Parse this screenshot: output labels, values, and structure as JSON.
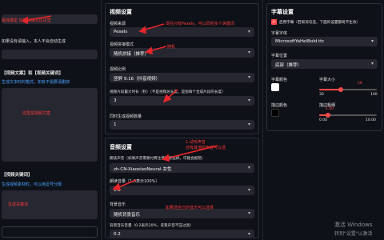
{
  "left": {
    "topInputValue": "",
    "topNote": "最强模型 内容请填写在这里",
    "hint1": "如果没有请输入，本人不会自动生成",
    "hint2": "【视频文案】和【视频关键词】",
    "blueHint1": "生成文本时的格式，如有不需要请删掉",
    "textareaNote": "这里是视频文案",
    "sectionTitle": "【视频关键词】",
    "blueHint2": "生成视频素材时，可以用逗号分隔",
    "keywordNote": "生成关键词"
  },
  "mid": {
    "sectionTitle": "视频设置",
    "sourceLabel": "视频来源",
    "sourceValue": "Pexels",
    "sourceNote": "现在只有Pexels，可以同时多个关键词",
    "concatLabel": "视频拼接模式",
    "concatValue": "随机拼接（推荐）",
    "concatNote": "随机",
    "ratioLabel": "视频比例",
    "ratioValue": "竖屏 9:16（抖音视频）",
    "clipLabel": "视频片段最大时长（秒）（不是视频总长度，是指每个合成片段的长度）",
    "clipValue": "3",
    "countLabel": "同时生成视频数量",
    "countValue": "1",
    "audioTitle": "音频设置",
    "voiceLabel": "朗读声音（如果声音需要付费注意不要选择，可能会报错）",
    "voiceValue": "zh-CN-XiaoxiaoNeural-女性",
    "voiceNote1": "1.试听声音",
    "voiceNote2": "还有其他的声音可以选",
    "volumeLabel": "朗读音量（1.0表示100%）",
    "volumeValue": "1.0",
    "bgmLabel": "背景音乐",
    "bgmValue": "随机背景音乐",
    "bgmNote": "如果选自己的音乐可以选择",
    "bgmVolumeLabel": "背景音乐音量（0.2表示20%，背景声音不宜过高）",
    "bgmVolumeValue": "0.2"
  },
  "right": {
    "sectionTitle": "字幕设置",
    "enableLabel": "启用字幕（若取消勾选，下面的设置都将不生效）",
    "enableChecked": true,
    "fontLabel": "字幕字体",
    "fontValue": "MicrosoftYaHeiBold.ttc",
    "positionLabel": "字幕位置",
    "positionValue": "底部（推荐）",
    "fontColorLabel": "字幕颜色",
    "fontColor": "#ffffff",
    "fontSizeLabel": "字幕大小",
    "fontSizeValue": 56,
    "fontSizeMin": 30,
    "fontSizeMax": 100,
    "strokeColorLabel": "描边颜色",
    "strokeColor": "#000000",
    "strokeWidthLabel": "描边粗细",
    "strokeWidthValue": "1.50",
    "strokeWidthFraction": 0.15,
    "strokeMin": "0.00",
    "strokeMax": "10.00",
    "fontSizeMinText": "30",
    "fontSizeMaxText": "100",
    "fontSizeValueText": "56"
  },
  "watermark": {
    "line1": "激活 Windows",
    "line2": "转到\"设置\"以激活"
  }
}
